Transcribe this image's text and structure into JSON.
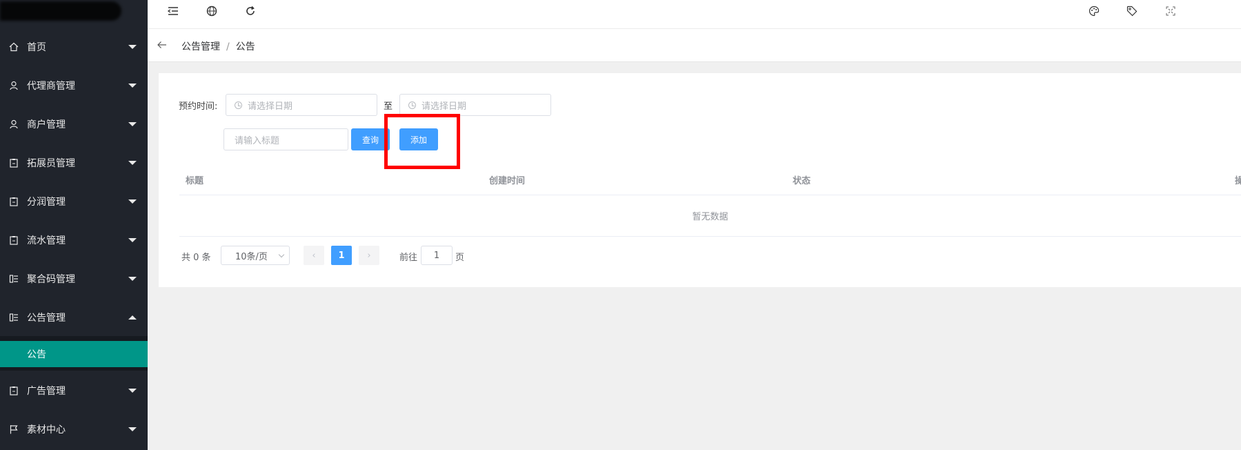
{
  "sidebar": {
    "items": [
      {
        "label": "首页",
        "icon": "home-icon",
        "expanded": false
      },
      {
        "label": "代理商管理",
        "icon": "user-icon",
        "expanded": false
      },
      {
        "label": "商户管理",
        "icon": "user-icon",
        "expanded": false
      },
      {
        "label": "拓展员管理",
        "icon": "clipboard-icon",
        "expanded": false
      },
      {
        "label": "分润管理",
        "icon": "clipboard-icon",
        "expanded": false
      },
      {
        "label": "流水管理",
        "icon": "clipboard-icon",
        "expanded": false
      },
      {
        "label": "聚合码管理",
        "icon": "list-icon",
        "expanded": false
      },
      {
        "label": "公告管理",
        "icon": "list-icon",
        "expanded": true
      },
      {
        "label": "广告管理",
        "icon": "clipboard-icon",
        "expanded": false
      },
      {
        "label": "素材中心",
        "icon": "flag-icon",
        "expanded": false
      }
    ],
    "active_sub": {
      "label": "公告"
    },
    "active_color": "#009688",
    "background": "#20242c"
  },
  "header": {
    "icons": [
      "menu-fold-icon",
      "globe-icon",
      "refresh-icon",
      "palette-icon",
      "tag-icon",
      "fullscreen-icon"
    ]
  },
  "breadcrumb": {
    "items": [
      "公告管理",
      "公告"
    ],
    "separator": "/"
  },
  "filters": {
    "time_label": "预约时间:",
    "start_placeholder": "请选择日期",
    "range_sep": "至",
    "end_placeholder": "请选择日期",
    "title_placeholder": "请输入标题",
    "search_label": "查询",
    "add_label": "添加",
    "button_color": "#409eff"
  },
  "table": {
    "columns": [
      "标题",
      "创建时间",
      "状态",
      "操"
    ],
    "empty_text": "暂无数据"
  },
  "pagination": {
    "total_text": "共 0 条",
    "page_size": "10条/页",
    "current_page": "1",
    "prev": "‹",
    "next": "›",
    "goto_label": "前往",
    "goto_value": "1",
    "goto_suffix": "页"
  },
  "annotation": {
    "highlight_color": "#ff0000"
  }
}
